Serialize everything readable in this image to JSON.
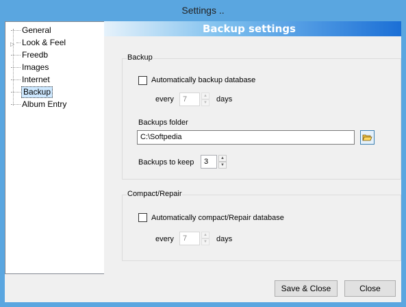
{
  "window": {
    "title": "Settings .."
  },
  "tree": {
    "items": [
      {
        "label": "General",
        "selected": false,
        "expandable": false
      },
      {
        "label": "Look & Feel",
        "selected": false,
        "expandable": true
      },
      {
        "label": "Freedb",
        "selected": false,
        "expandable": false
      },
      {
        "label": "Images",
        "selected": false,
        "expandable": false
      },
      {
        "label": "Internet",
        "selected": false,
        "expandable": false
      },
      {
        "label": "Backup",
        "selected": true,
        "expandable": false
      },
      {
        "label": "Album Entry",
        "selected": false,
        "expandable": false
      }
    ]
  },
  "pane": {
    "title": "Backup settings",
    "backup_group": {
      "label": "Backup",
      "auto_backup_label": "Automatically backup database",
      "auto_backup_checked": false,
      "every_label": "every",
      "every_value": "7",
      "days_label": "days",
      "folder_label": "Backups  folder",
      "folder_value": "C:\\Softpedia",
      "keep_label": "Backups to keep",
      "keep_value": "3"
    },
    "compact_group": {
      "label": "Compact/Repair",
      "auto_compact_label": "Automatically compact/Repair database",
      "auto_compact_checked": false,
      "every_label": "every",
      "every_value": "7",
      "days_label": "days"
    }
  },
  "footer": {
    "save_close_label": "Save & Close",
    "close_label": "Close"
  },
  "icons": {
    "browse": "folder-open-icon",
    "expander": "triangle-right-icon"
  },
  "colors": {
    "title_bar": "#5aa6e0",
    "header_gradient_end": "#1b6fd6",
    "selection": "#cde8ff"
  }
}
